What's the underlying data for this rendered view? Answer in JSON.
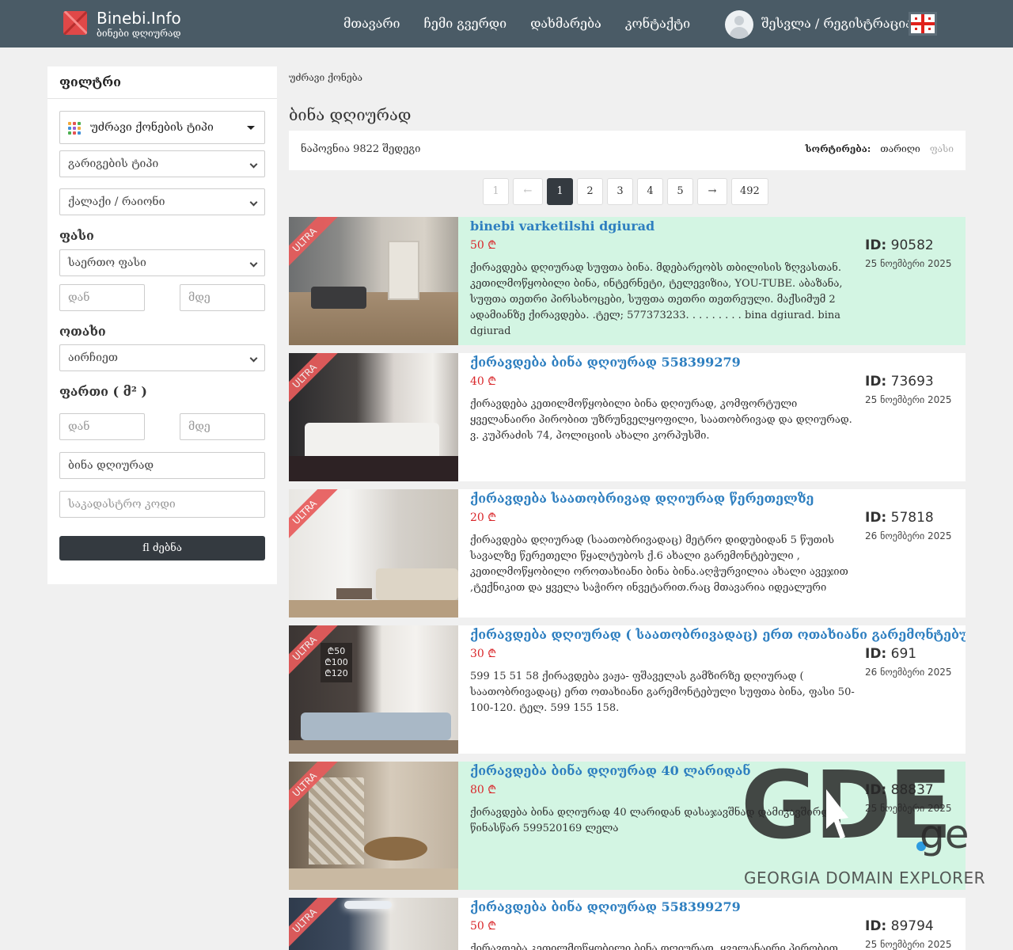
{
  "header": {
    "site_name": "Binebi.Info",
    "tagline": "ბინები დღიურად",
    "nav": [
      "მთავარი",
      "ჩემი გვერდი",
      "დახმარება",
      "კონტაქტი"
    ],
    "login": "შესვლა / რეგისტრაცია"
  },
  "sidebar": {
    "title": "ფილტრი",
    "property_type": "უძრავი ქონების ტიპი",
    "deal_type": "გარიგების ტიპი",
    "city": "ქალაქი / რაიონი",
    "price_label": "ფასი",
    "price_select": "საერთო ფასი",
    "from_ph": "დან",
    "to_ph": "მდე",
    "room_label": "ოთახი",
    "room_select": "აირჩიეთ",
    "area_label": "ფართი ( მ² )",
    "keyword": "ბინა დღიურად",
    "cadastral_ph": "საკადასტრო კოდი",
    "search_label": "fl ძებნა"
  },
  "breadcrumb": "უძრავი ქონება",
  "page_title": "ბინა დღიურად",
  "results": {
    "found": "ნაპოვნია 9822 შედეგი",
    "sort_label": "სორტირება:",
    "sort_date": "თარიღი",
    "sort_price": "ფასი"
  },
  "pagination": [
    "1",
    "←",
    "1",
    "2",
    "3",
    "4",
    "5",
    "→",
    "492"
  ],
  "ribbon": "ULTRA",
  "id_label": "ID:",
  "listings": [
    {
      "title": "binebi varketilshi dgiurad",
      "price": "50 ₾",
      "desc": "ქირავდება დღიურად სუფთა ბინა. მდებარეობს თბილისის ზღვასთან. კეთილმოწყობილი ბინა, ინტერნეტი, ტელევიზია, YOU-TUBE. აბაზანა, სუფთა თეთრი პირსახოცები, სუფთა თეთრი თეთრეული. მაქსიმუმ 2 ადამიანზე ქირავდება. .ტელ; 577373233. . . . . . . . . bina dgiurad. bina dgiurad",
      "id": "90582",
      "date": "25 ნოემბერი 2025",
      "highlight": true
    },
    {
      "title": "ქირავდება ბინა დღიურად 558399279",
      "price": "40 ₾",
      "desc": "ქირავდება კეთილმოწყობილი ბინა დღიურად, კომფორტული ყველანაირი პირობით უზრუნველყოფილი, საათობრივად და დღიურად. ვ. კუპრაძის 74, პოლიციის ახალი კორპუსში.",
      "id": "73693",
      "date": "25 ნოემბერი 2025",
      "highlight": false
    },
    {
      "title": "ქირავდება საათობრივად დღიურად წერეთელზე",
      "price": "20 ₾",
      "desc": "ქირავდება დღიურად (საათობრივადაც) მეტრო დიდუბიდან 5 წუთის სავალზე წერეთელი წყალტუბოს ქ.6 ახალი გარემონტებული , კეთილმოწყობილი ოროთახიანი ბინა ბინა.აღჭურვილია ახალი ავეჯით ,ტექნიკით და ყველა საჭირო ინვეტარით.რაც მთავარია იდეალური",
      "id": "57818",
      "date": "26 ნოემბერი 2025",
      "highlight": false
    },
    {
      "title": "ქირავდება დღიურად ( საათობრივადაც) ერთ ოთახიანი გარემონტებული",
      "price": "30 ₾",
      "desc": "599 15 51 58 ქირავდება ვაჟა- ფშაველას გამზირზე დღიურად ( საათობრივადაც) ერთ ოთახიანი გარემონტებული სუფთა ბინა, ფასი 50-100-120. ტელ. 599 155 158.",
      "id": "691",
      "date": "26 ნოემბერი 2025",
      "highlight": false
    },
    {
      "title": "ქირავდება ბინა დღიურად 40 ლარიდან",
      "price": "80 ₾",
      "desc": "ქირავდება ბინა დღიურად 40 ლარიდან დასაჯავშნად დამიკავშირდით წინასწარ 599520169 ლელა",
      "id": "88837",
      "date": "25 ნოემბერი 2025",
      "highlight": true
    },
    {
      "title": "ქირავდება ბინა დღიურად 558399279",
      "price": "50 ₾",
      "desc": "ქირავდება კეთილმოწყობილი ბინა დღიურად, ყველანაირი პირობით",
      "id": "89794",
      "date": "25 ნოემბერი 2025",
      "highlight": false
    }
  ],
  "watermark": {
    "big": "GDE",
    "ge": "ge",
    "sub": "GEORGIA DOMAIN EXPLORER"
  }
}
